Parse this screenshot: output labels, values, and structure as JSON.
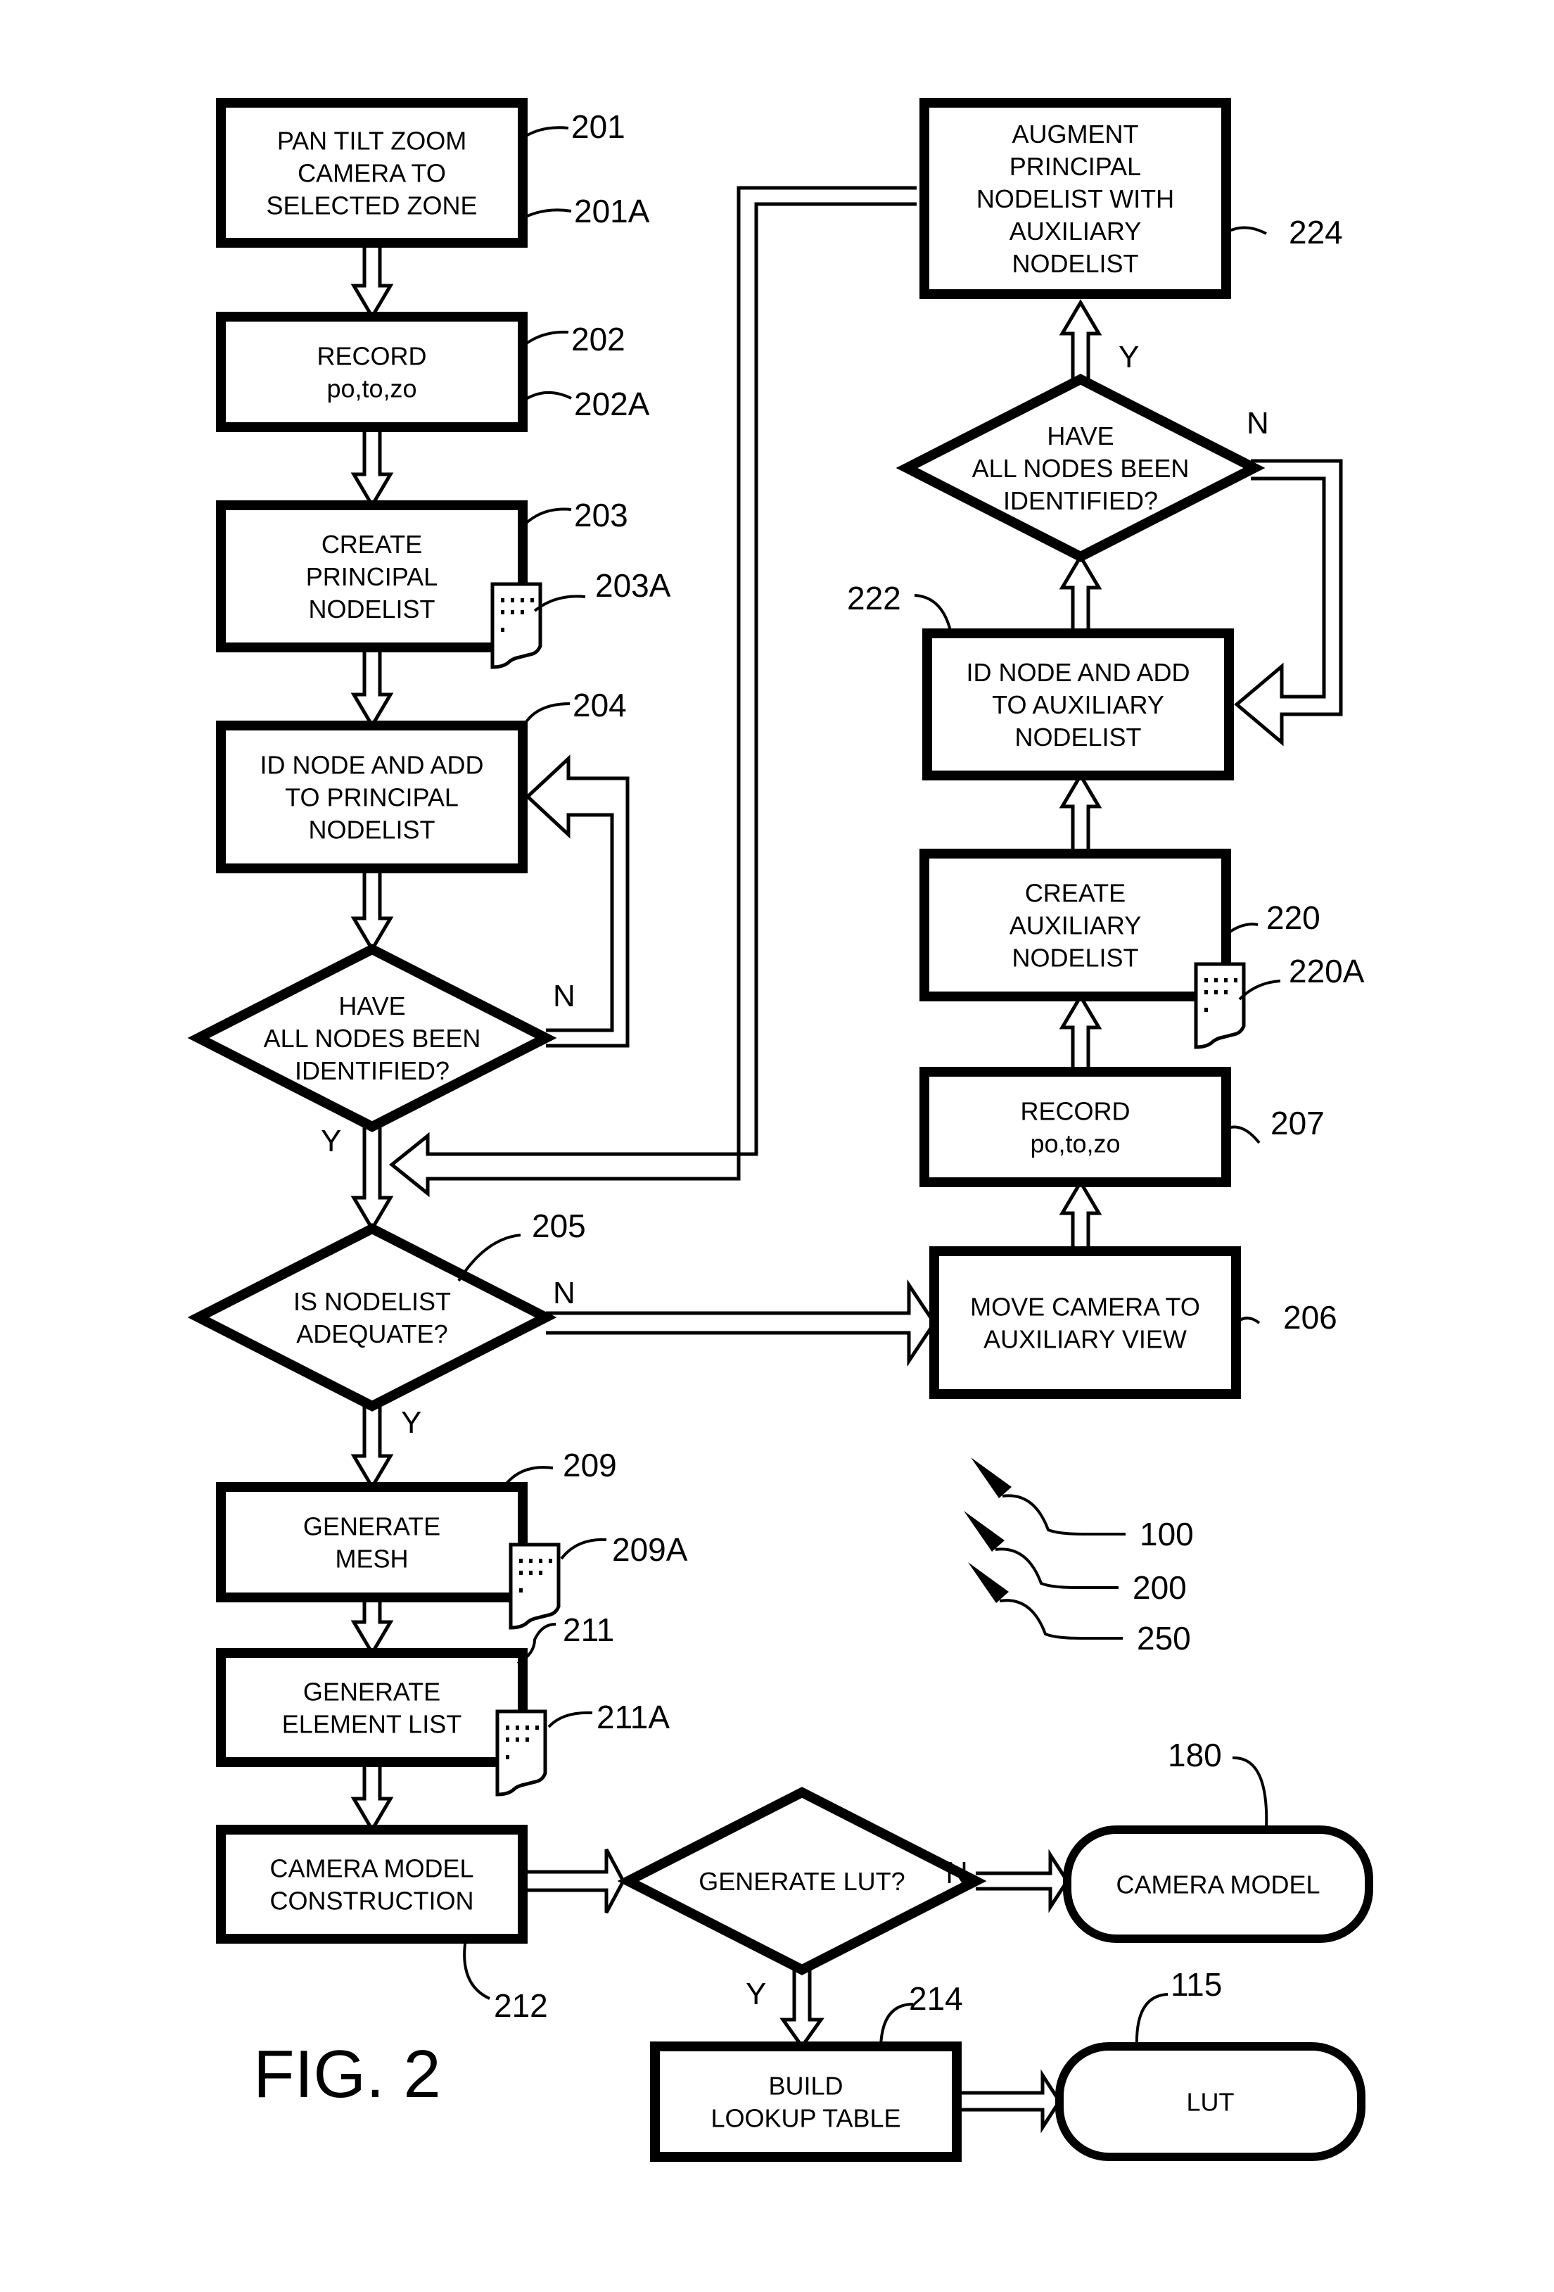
{
  "figure_label": "FIG. 2",
  "steps": {
    "s201": {
      "lines": [
        "PAN TILT ZOOM",
        "CAMERA TO",
        "SELECTED ZONE"
      ],
      "ref": "201",
      "ref_a": "201A"
    },
    "s202": {
      "lines": [
        "RECORD",
        "po,to,zo"
      ],
      "ref": "202",
      "ref_a": "202A"
    },
    "s203": {
      "lines": [
        "CREATE",
        "PRINCIPAL",
        "NODELIST"
      ],
      "ref": "203",
      "ref_a": "203A"
    },
    "s204": {
      "lines": [
        "ID NODE AND ADD",
        "TO PRINCIPAL",
        "NODELIST"
      ],
      "ref": "204"
    },
    "d_principal": {
      "lines": [
        "HAVE",
        "ALL NODES BEEN",
        "IDENTIFIED?"
      ],
      "yes": "Y",
      "no": "N"
    },
    "d205": {
      "lines": [
        "IS NODELIST",
        "ADEQUATE?"
      ],
      "ref": "205",
      "yes": "Y",
      "no": "N"
    },
    "s209": {
      "lines": [
        "GENERATE",
        "MESH"
      ],
      "ref": "209",
      "ref_a": "209A"
    },
    "s211": {
      "lines": [
        "GENERATE",
        "ELEMENT LIST"
      ],
      "ref": "211",
      "ref_a": "211A"
    },
    "s212": {
      "lines": [
        "CAMERA MODEL",
        "CONSTRUCTION"
      ],
      "ref": "212"
    },
    "d_lut": {
      "lines": [
        "GENERATE LUT?"
      ],
      "yes": "Y",
      "no": "N"
    },
    "s214": {
      "lines": [
        "BUILD",
        "LOOKUP TABLE"
      ],
      "ref": "214"
    },
    "t180": {
      "lines": [
        "CAMERA MODEL"
      ],
      "ref": "180"
    },
    "t115": {
      "lines": [
        "LUT"
      ],
      "ref": "115"
    },
    "s206": {
      "lines": [
        "MOVE CAMERA TO",
        "AUXILIARY VIEW"
      ],
      "ref": "206"
    },
    "s207": {
      "lines": [
        "RECORD",
        "po,to,zo"
      ],
      "ref": "207"
    },
    "s220": {
      "lines": [
        "CREATE",
        "AUXILIARY",
        "NODELIST"
      ],
      "ref": "220",
      "ref_a": "220A"
    },
    "s222": {
      "lines": [
        "ID NODE AND ADD",
        "TO AUXILIARY",
        "NODELIST"
      ],
      "ref": "222"
    },
    "d_aux": {
      "lines": [
        "HAVE",
        "ALL NODES BEEN",
        "IDENTIFIED?"
      ],
      "yes": "Y",
      "no": "N"
    },
    "s224": {
      "lines": [
        "AUGMENT",
        "PRINCIPAL",
        "NODELIST WITH",
        "AUXILIARY",
        "NODELIST"
      ],
      "ref": "224"
    }
  },
  "system_refs": [
    "100",
    "200",
    "250"
  ]
}
